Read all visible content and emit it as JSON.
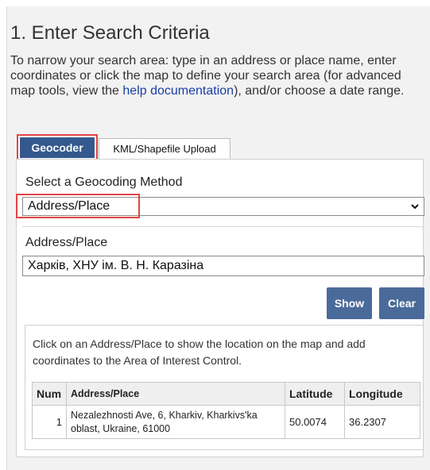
{
  "section": {
    "title": "1. Enter Search Criteria",
    "intro_before_link": "To narrow your search area: type in an address or place name, enter coordinates or click the map to define your search area (for advanced map tools, view the ",
    "intro_link": "help documentation",
    "intro_after_link": "), and/or choose a date range."
  },
  "tabs": [
    {
      "label": "Geocoder",
      "active": true
    },
    {
      "label": "KML/Shapefile Upload",
      "active": false
    }
  ],
  "geocoder": {
    "method_label": "Select a Geocoding Method",
    "method_value": "Address/Place",
    "address_label": "Address/Place",
    "address_value": "Харків, ХНУ ім. В. Н. Каразіна",
    "show_button": "Show",
    "clear_button": "Clear"
  },
  "results": {
    "note": "Click on an Address/Place to show the location on the map and add coordinates to the Area of Interest Control.",
    "columns": [
      "Num",
      "Address/Place",
      "Latitude",
      "Longitude"
    ],
    "rows": [
      {
        "num": "1",
        "address": "Nezalezhnosti Ave, 6, Kharkiv, Kharkivs'ka oblast, Ukraine, 61000",
        "latitude": "50.0074",
        "longitude": "36.2307"
      }
    ]
  },
  "colors": {
    "active_tab": "#34598f",
    "button": "#4a6b9a",
    "highlight": "#e04545",
    "link": "#1a3ea8"
  },
  "icons": {
    "select_chevron": "chevron-down-icon"
  }
}
